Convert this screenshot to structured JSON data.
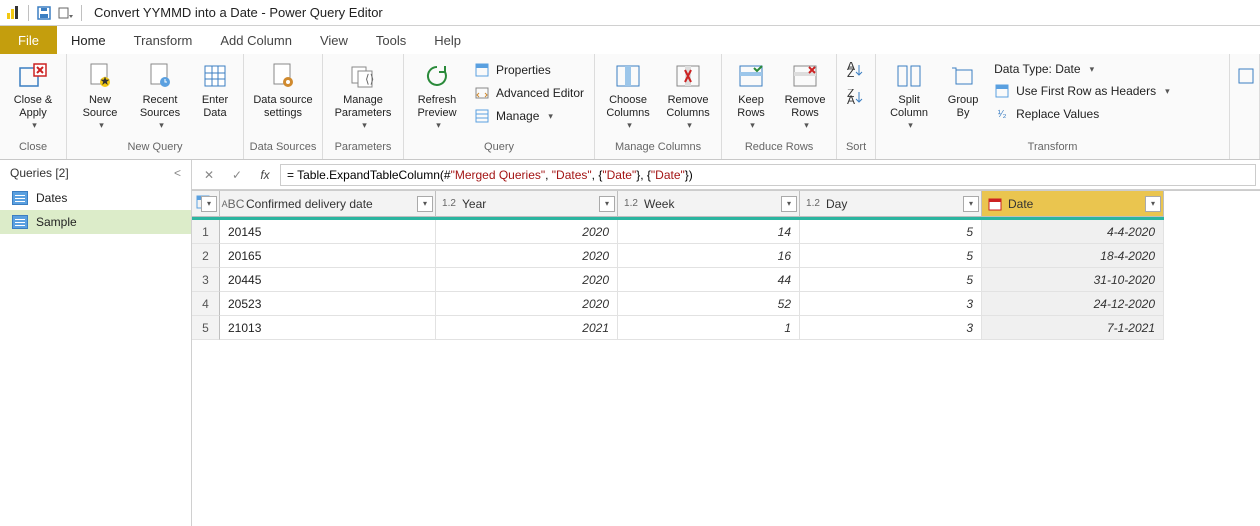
{
  "title": "Convert YYMMD into a Date - Power Query Editor",
  "tabs": {
    "file": "File",
    "home": "Home",
    "transform": "Transform",
    "addcol": "Add Column",
    "view": "View",
    "tools": "Tools",
    "help": "Help"
  },
  "ribbon": {
    "close_apply": "Close &\nApply",
    "new_source": "New\nSource",
    "recent_sources": "Recent\nSources",
    "enter_data": "Enter\nData",
    "data_source_settings": "Data source\nsettings",
    "manage_parameters": "Manage\nParameters",
    "refresh_preview": "Refresh\nPreview",
    "properties": "Properties",
    "advanced_editor": "Advanced Editor",
    "manage": "Manage",
    "choose_columns": "Choose\nColumns",
    "remove_columns": "Remove\nColumns",
    "keep_rows": "Keep\nRows",
    "remove_rows": "Remove\nRows",
    "split_column": "Split\nColumn",
    "group_by": "Group\nBy",
    "data_type": "Data Type: Date",
    "first_row_headers": "Use First Row as Headers",
    "replace_values": "Replace Values",
    "groups": {
      "close": "Close",
      "new_query": "New Query",
      "data_sources": "Data Sources",
      "parameters": "Parameters",
      "query": "Query",
      "manage_columns": "Manage Columns",
      "reduce_rows": "Reduce Rows",
      "sort": "Sort",
      "transform": "Transform"
    }
  },
  "queries": {
    "header": "Queries [2]",
    "items": [
      "Dates",
      "Sample"
    ],
    "selected": 1
  },
  "formula": {
    "prefix": "= Table.ExpandTableColumn(#",
    "q_merged": "\"Merged Queries\"",
    "mid1": ", ",
    "q_dates": "\"Dates\"",
    "mid2": ", {",
    "q_date1": "\"Date\"",
    "mid3": "}, {",
    "q_date2": "\"Date\"",
    "suffix": "})"
  },
  "columns": {
    "confirmed": "Confirmed delivery date",
    "year": "Year",
    "week": "Week",
    "day": "Day",
    "date": "Date"
  },
  "dtypes": {
    "abc": "ABC",
    "num": "1.2",
    "date": "▦"
  },
  "rows": [
    {
      "n": "1",
      "c": "20145",
      "y": "2020",
      "w": "14",
      "d": "5",
      "date": "4-4-2020"
    },
    {
      "n": "2",
      "c": "20165",
      "y": "2020",
      "w": "16",
      "d": "5",
      "date": "18-4-2020"
    },
    {
      "n": "3",
      "c": "20445",
      "y": "2020",
      "w": "44",
      "d": "5",
      "date": "31-10-2020"
    },
    {
      "n": "4",
      "c": "20523",
      "y": "2020",
      "w": "52",
      "d": "3",
      "date": "24-12-2020"
    },
    {
      "n": "5",
      "c": "21013",
      "y": "2021",
      "w": "1",
      "d": "3",
      "date": "7-1-2021"
    }
  ]
}
